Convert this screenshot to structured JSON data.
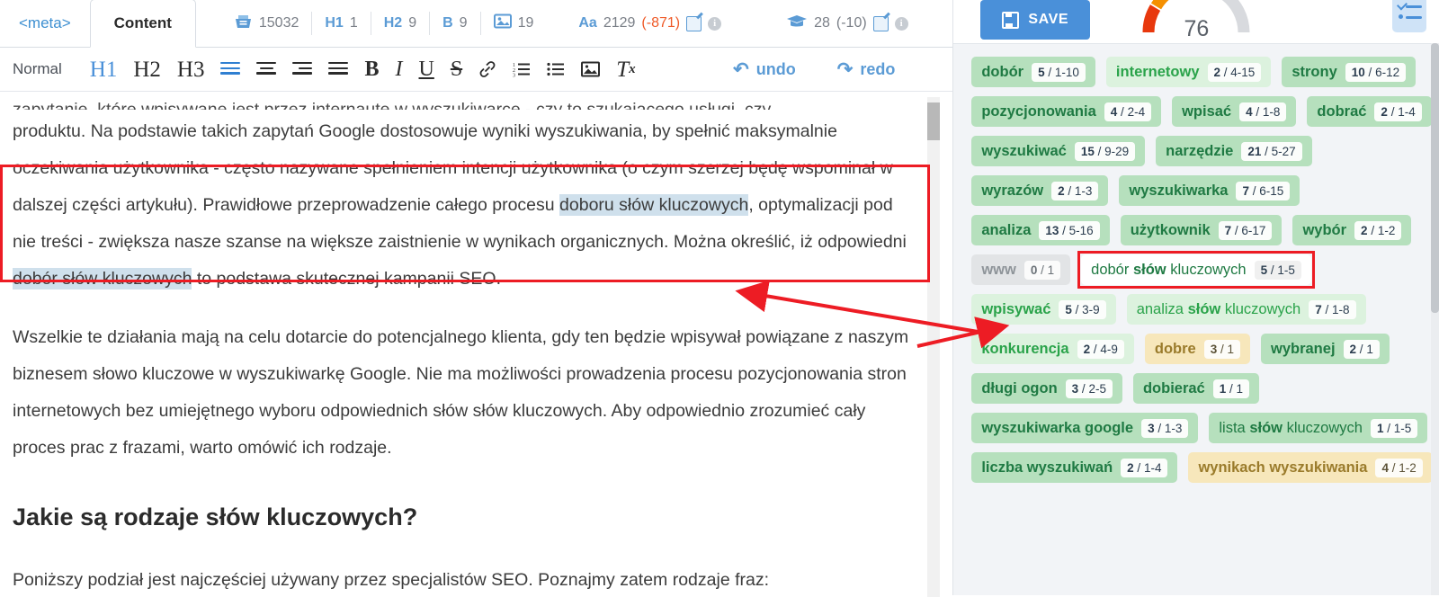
{
  "editor": {
    "tabs": [
      {
        "label": "<meta>",
        "active": false
      },
      {
        "label": "Content",
        "active": true
      }
    ],
    "stats": [
      {
        "icon": "basket-icon",
        "value": "15032"
      },
      {
        "icon": "h1-icon",
        "label": "H1",
        "value": "1"
      },
      {
        "icon": "h2-icon",
        "label": "H2",
        "value": "9"
      },
      {
        "icon": "bold-icon",
        "label": "B",
        "value": "9"
      },
      {
        "icon": "image-icon",
        "value": "19"
      },
      {
        "icon": "font-size-icon",
        "label": "Aa",
        "value": "2129",
        "delta": "(-871)"
      },
      {
        "icon": "graduation-cap-icon",
        "value": "28",
        "delta": "(-10)"
      }
    ],
    "toolbar": {
      "style_label": "Normal",
      "h1": "H1",
      "h2": "H2",
      "h3": "H3",
      "bold": "B",
      "italic": "I",
      "underline": "U",
      "strike": "S",
      "undo_label": "undo",
      "redo_label": "redo"
    },
    "document": {
      "clipped_line": "zapytanie, które wpisywane jest przez internautę w wyszukiwarce - czy to szukającego usługi, czy",
      "paragraph1_a": "produktu. Na podstawie takich zapytań Google dostosowuje wyniki wyszukiwania, by spełnić maksymalnie oczekiwania użytkownika - często nazywane spełnieniem intencji użytkownika (o czym szerzej będę wspominał w dalszej części artykułu). Prawidłowe przeprowadzenie całego procesu ",
      "paragraph1_hl1": "doboru słów kluczowych",
      "paragraph1_b": ", optymalizacji pod nie treści - zwiększa nasze szanse na większe zaistnienie w wynikach organicznych. Można określić, iż odpowiedni ",
      "paragraph1_hl2": "dobór słów kluczowych",
      "paragraph1_c": " to podstawa skutecznej kampanii SEO.",
      "paragraph2": "Wszelkie te działania mają na celu dotarcie do potencjalnego klienta, gdy ten będzie wpisywał powiązane z naszym biznesem słowo kluczowe w wyszukiwarkę Google. Nie ma możliwości prowadzenia procesu pozycjonowania stron internetowych bez umiejętnego wyboru odpowiednich słów słów kluczowych. Aby odpowiednio zrozumieć cały proces prac z frazami, warto omówić ich rodzaje.",
      "heading2": "Jakie są rodzaje słów kluczowych?",
      "paragraph3": "Poniższy podział jest najczęściej używany przez specjalistów SEO. Poznajmy zatem rodzaje fraz:"
    }
  },
  "right_panel": {
    "save_label": "SAVE",
    "score": "76",
    "checklist_icon": "checklist-icon",
    "keywords": [
      {
        "label": "dobór",
        "count": "5",
        "range": "1-10",
        "style": "green"
      },
      {
        "label": "internetowy",
        "count": "2",
        "range": "4-15",
        "style": "green-l"
      },
      {
        "label": "strony",
        "count": "10",
        "range": "6-12",
        "style": "green"
      },
      {
        "label": "pozycjonowania",
        "count": "4",
        "range": "2-4",
        "style": "green"
      },
      {
        "label": "wpisać",
        "count": "4",
        "range": "1-8",
        "style": "green"
      },
      {
        "label": "dobrać",
        "count": "2",
        "range": "1-4",
        "style": "green"
      },
      {
        "label": "wyszukiwać",
        "count": "15",
        "range": "9-29",
        "style": "green"
      },
      {
        "label": "narzędzie",
        "count": "21",
        "range": "5-27",
        "style": "green"
      },
      {
        "label": "wyrazów",
        "count": "2",
        "range": "1-3",
        "style": "green"
      },
      {
        "label": "wyszukiwarka",
        "count": "7",
        "range": "6-15",
        "style": "green"
      },
      {
        "label": "analiza",
        "count": "13",
        "range": "5-16",
        "style": "green"
      },
      {
        "label": "użytkownik",
        "count": "7",
        "range": "6-17",
        "style": "green"
      },
      {
        "label": "wybór",
        "count": "2",
        "range": "1-2",
        "style": "green"
      },
      {
        "label": "www",
        "count": "0",
        "range": "1",
        "style": "gray"
      },
      {
        "label": "dobór słów kluczowych",
        "bold_word": "słów",
        "count": "5",
        "range": "1-5",
        "style": "white",
        "highlighted": true
      },
      {
        "label": "wpisywać",
        "count": "5",
        "range": "3-9",
        "style": "green-l"
      },
      {
        "label": "analiza słów kluczowych",
        "bold_word": "słów",
        "count": "7",
        "range": "1-8",
        "style": "green-l"
      },
      {
        "label": "konkurencja",
        "count": "2",
        "range": "4-9",
        "style": "green-l"
      },
      {
        "label": "dobre",
        "count": "3",
        "range": "1",
        "style": "yellow"
      },
      {
        "label": "wybranej",
        "count": "2",
        "range": "1",
        "style": "green"
      },
      {
        "label": "długi ogon",
        "count": "3",
        "range": "2-5",
        "style": "green"
      },
      {
        "label": "dobierać",
        "count": "1",
        "range": "1",
        "style": "green"
      },
      {
        "label": "wyszukiwarka google",
        "count": "3",
        "range": "1-3",
        "style": "green"
      },
      {
        "label": "lista słów kluczowych",
        "bold_word": "słów",
        "count": "1",
        "range": "1-5",
        "style": "green"
      },
      {
        "label": "liczba wyszukiwań",
        "count": "2",
        "range": "1-4",
        "style": "green"
      },
      {
        "label": "wynikach wyszukiwania",
        "count": "4",
        "range": "1-2",
        "style": "yellow"
      }
    ]
  },
  "annotations": {
    "accent_red": "#ed1c24",
    "highlight_blue": "#cfe0ec",
    "brand_blue": "#4a90d9"
  }
}
